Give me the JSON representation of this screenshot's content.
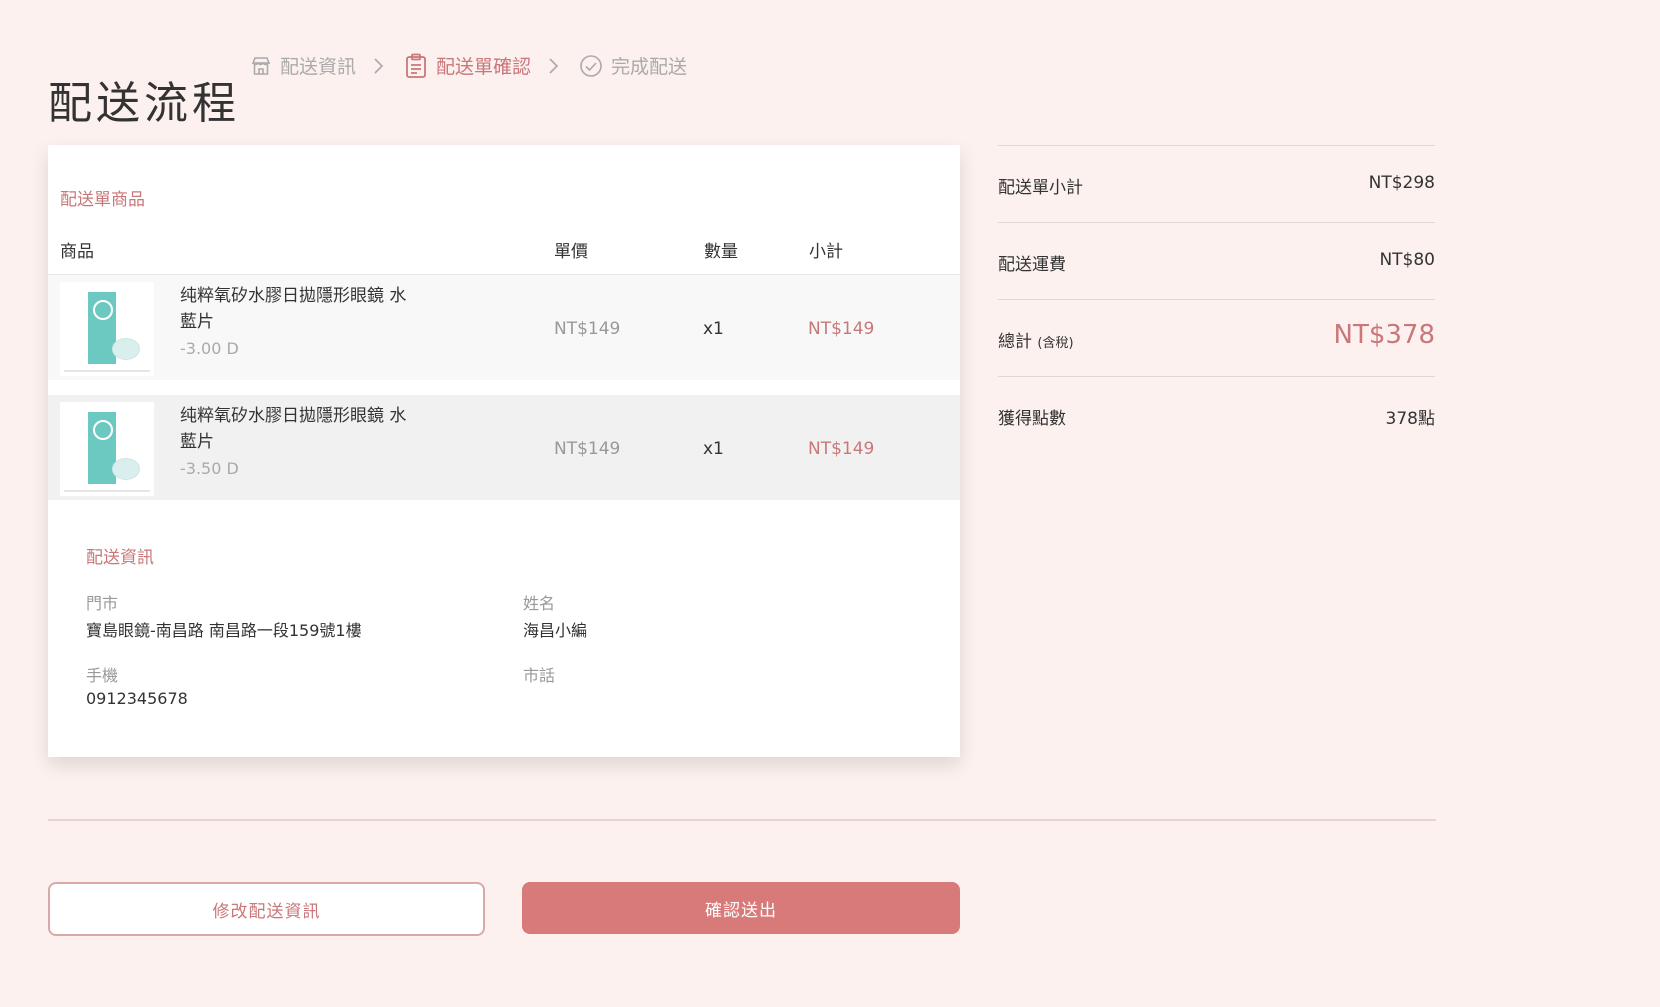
{
  "header": {
    "title": "配送流程",
    "steps": [
      {
        "label": "配送資訊",
        "icon": "store-icon",
        "active": false
      },
      {
        "label": "配送單確認",
        "icon": "clipboard-icon",
        "active": true
      },
      {
        "label": "完成配送",
        "icon": "check-circle-icon",
        "active": false
      }
    ]
  },
  "order": {
    "section_title": "配送單商品",
    "columns": {
      "product": "商品",
      "price": "單價",
      "qty": "數量",
      "subtotal": "小計"
    },
    "items": [
      {
        "name": "纯粹氧矽水膠日拋隱形眼鏡 水藍片",
        "spec": "-3.00 D",
        "price": "NT$149",
        "qty": "x1",
        "subtotal": "NT$149"
      },
      {
        "name": "纯粹氧矽水膠日拋隱形眼鏡 水藍片",
        "spec": "-3.50 D",
        "price": "NT$149",
        "qty": "x1",
        "subtotal": "NT$149"
      }
    ]
  },
  "delivery": {
    "section_title": "配送資訊",
    "store_label": "門市",
    "store_value": "寶島眼鏡-南昌路 南昌路一段159號1樓",
    "name_label": "姓名",
    "name_value": "海昌小編",
    "mobile_label": "手機",
    "mobile_value": "0912345678",
    "phone_label": "市話",
    "phone_value": ""
  },
  "summary": {
    "subtotal_label": "配送單小計",
    "subtotal_value": "NT$298",
    "shipping_label": "配送運費",
    "shipping_value": "NT$80",
    "total_label": "總計",
    "total_note": "(含稅)",
    "total_value": "NT$378",
    "points_label": "獲得點數",
    "points_value": "378點"
  },
  "actions": {
    "edit_label": "修改配送資訊",
    "submit_label": "確認送出"
  },
  "colors": {
    "accent": "#c9777a",
    "button_fill": "#d97a7a",
    "background": "#fcf1ef"
  }
}
